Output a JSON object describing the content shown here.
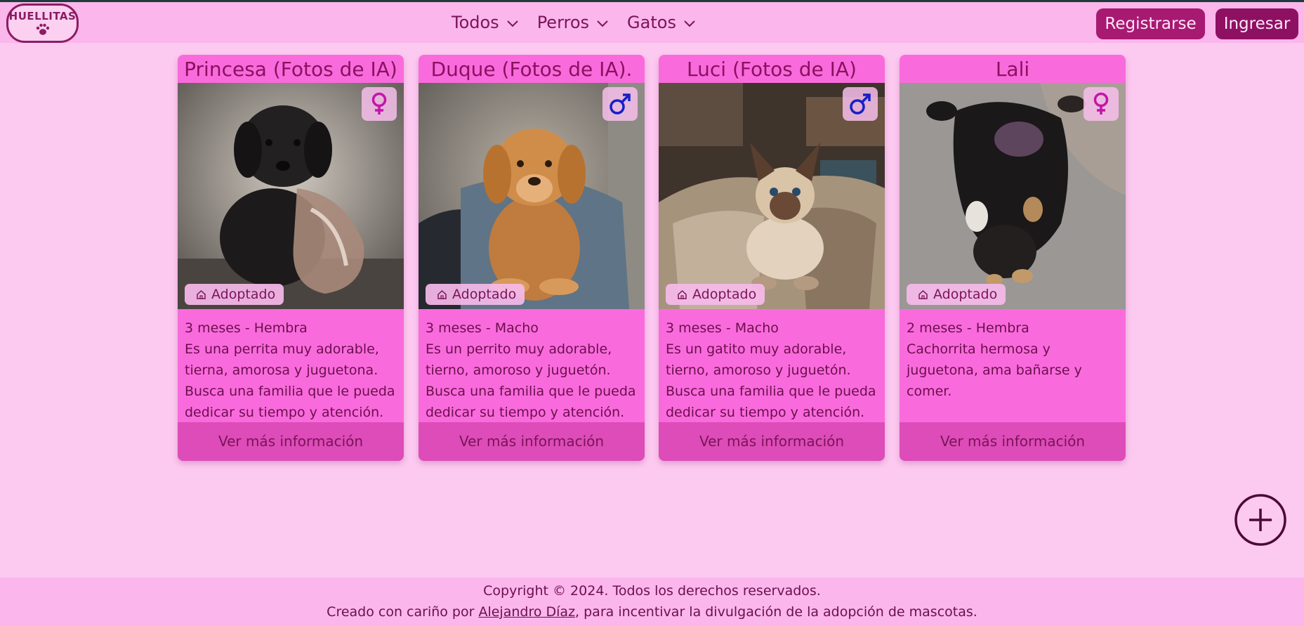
{
  "header": {
    "logo_text": "HUELLITAS",
    "nav": [
      "Todos",
      "Perros",
      "Gatos"
    ],
    "register_label": "Registrarse",
    "login_label": "Ingresar"
  },
  "cards": [
    {
      "name": "Princesa (Fotos de IA)",
      "gender_icon": "female-icon",
      "status": "Adoptado",
      "age_sex": "3 meses - Hembra",
      "description": "Es una perrita muy adorable, tierna, amorosa y juguetona. Busca una familia que le pueda dedicar su tiempo y atención.",
      "cta": "Ver más información"
    },
    {
      "name": "Duque (Fotos de IA).",
      "gender_icon": "male-icon",
      "status": "Adoptado",
      "age_sex": "3 meses - Macho",
      "description": "Es un perrito muy adorable, tierno, amoroso y juguetón. Busca una familia que le pueda dedicar su tiempo y atención.",
      "cta": "Ver más información"
    },
    {
      "name": "Luci (Fotos de IA)",
      "gender_icon": "male-icon",
      "status": "Adoptado",
      "age_sex": "3 meses - Macho",
      "description": "Es un gatito muy adorable, tierno, amoroso y juguetón. Busca una familia que le pueda dedicar su tiempo y atención.",
      "cta": "Ver más información"
    },
    {
      "name": "Lali",
      "gender_icon": "female-icon",
      "status": "Adoptado",
      "age_sex": "2 meses - Hembra",
      "description": "Cachorrita hermosa y juguetona, ama bañarse y comer.",
      "cta": "Ver más información"
    }
  ],
  "fab_icon": "plus-circle-icon",
  "footer": {
    "copyright": "Copyright © 2024. Todos los derechos reservados.",
    "created_prefix": "Creado con cariño por ",
    "author": "Alejandro Díaz",
    "created_suffix": ", para incentivar la divulgación de la adopción de mascotas."
  },
  "colors": {
    "page_bg": "#fcc9f0",
    "navbar_bg": "#fbb6ec",
    "card_bg": "#f96bdc",
    "cta_bg": "#dd4cb8",
    "register_bg": "#a81972",
    "login_bg": "#8e1063",
    "text": "#6b0f4d",
    "female_icon": "#c414a8",
    "male_icon": "#1520c8"
  }
}
